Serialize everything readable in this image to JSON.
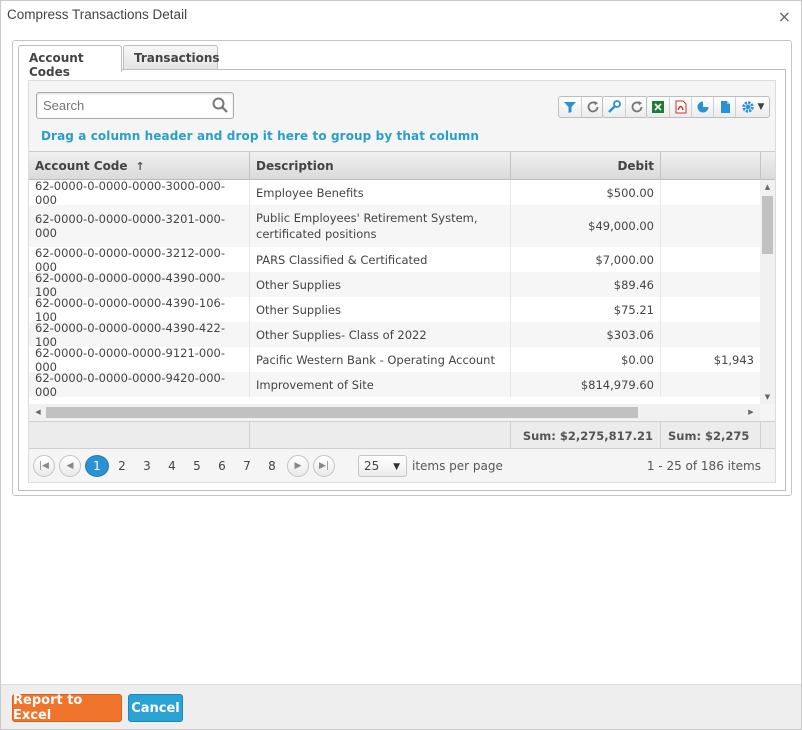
{
  "dialog": {
    "title": "Compress Transactions Detail",
    "close_glyph": "×"
  },
  "tabs": [
    {
      "label": "Account Codes",
      "active": true
    },
    {
      "label": "Transactions",
      "active": false
    }
  ],
  "search": {
    "placeholder": "Search",
    "value": ""
  },
  "toolbar_icons": [
    "filter-icon",
    "refresh-icon",
    "wrench-icon",
    "refresh-icon",
    "excel-icon",
    "pdf-icon",
    "chart-icon",
    "document-icon",
    "gear-icon",
    "dropdown-caret-icon"
  ],
  "group_hint": "Drag a column header and drop it here to group by that column",
  "columns": {
    "account_code": "Account Code",
    "description": "Description",
    "debit": "Debit",
    "sort_arrow": "↑"
  },
  "rows": [
    {
      "account_code": "62-0000-0-0000-0000-3000-000-000",
      "description": "Employee Benefits",
      "debit": "$500.00",
      "credit": ""
    },
    {
      "account_code": "62-0000-0-0000-0000-3201-000-000",
      "description": "Public Employees' Retirement System, certificated positions",
      "debit": "$49,000.00",
      "credit": ""
    },
    {
      "account_code": "62-0000-0-0000-0000-3212-000-000",
      "description": "PARS Classified & Certificated",
      "debit": "$7,000.00",
      "credit": ""
    },
    {
      "account_code": "62-0000-0-0000-0000-4390-000-100",
      "description": "Other Supplies",
      "debit": "$89.46",
      "credit": ""
    },
    {
      "account_code": "62-0000-0-0000-0000-4390-106-100",
      "description": "Other Supplies",
      "debit": "$75.21",
      "credit": ""
    },
    {
      "account_code": "62-0000-0-0000-0000-4390-422-100",
      "description": "Other Supplies- Class of 2022",
      "debit": "$303.06",
      "credit": ""
    },
    {
      "account_code": "62-0000-0-0000-0000-9121-000-000",
      "description": "Pacific Western Bank - Operating Account",
      "debit": "$0.00",
      "credit": "$1,943"
    },
    {
      "account_code": "62-0000-0-0000-0000-9420-000-000",
      "description": "Improvement of Site",
      "debit": "$814,979.60",
      "credit": ""
    }
  ],
  "footer": {
    "debit_sum": "Sum: $2,275,817.21",
    "credit_sum": "Sum: $2,275"
  },
  "pager": {
    "pages": [
      "1",
      "2",
      "3",
      "4",
      "5",
      "6",
      "7",
      "8"
    ],
    "current_page": "1",
    "page_size": "25",
    "per_page_label": "items per page",
    "info": "1 - 25 of 186 items"
  },
  "buttons": {
    "report_excel": "Report to Excel",
    "cancel": "Cancel"
  },
  "colors": {
    "accent_blue": "#2a92d2",
    "hint_blue": "#2a9fc9",
    "excel_orange": "#f0742c",
    "cancel_blue": "#2ba2d4"
  }
}
